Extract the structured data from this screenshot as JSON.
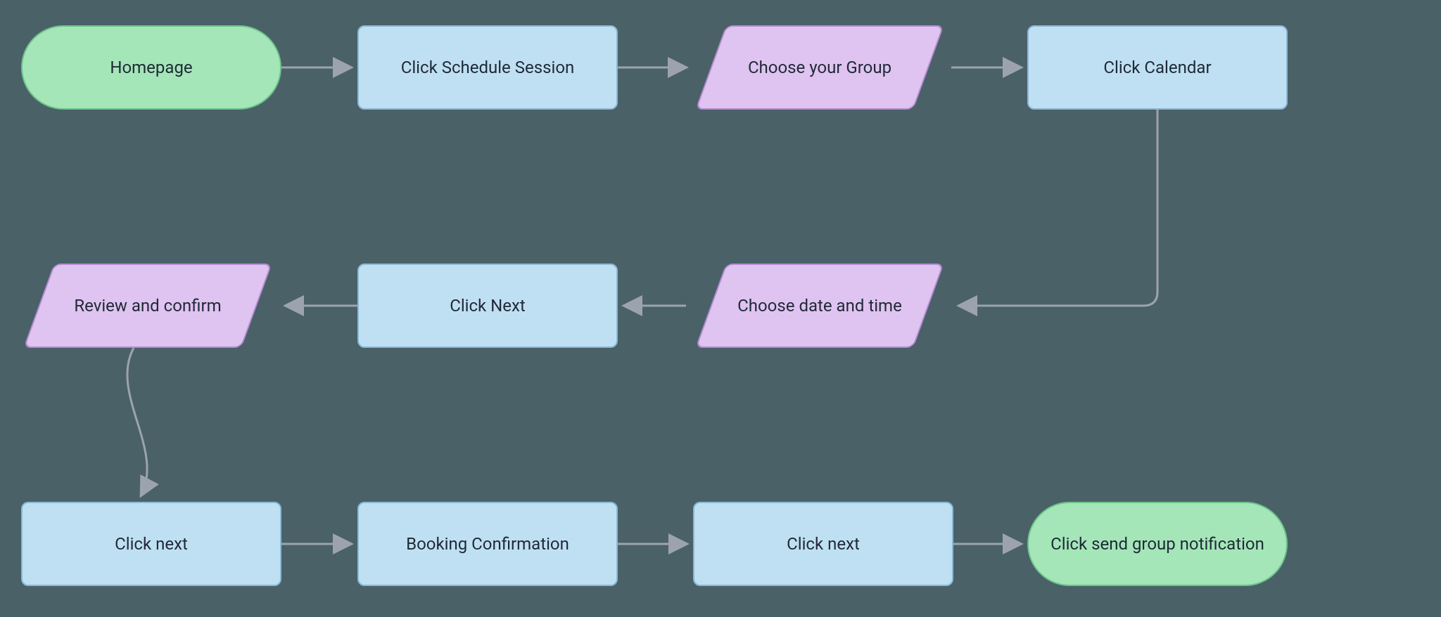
{
  "nodes": {
    "n1": "Homepage",
    "n2": "Click Schedule Session",
    "n3": "Choose your Group",
    "n4": "Click Calendar",
    "n5": "Choose date and time",
    "n6": "Click Next",
    "n7": "Review and confirm",
    "n8": "Click next",
    "n9": "Booking Confirmation",
    "n10": "Click next",
    "n11": "Click send group notification"
  },
  "colors": {
    "background": "#4a6168",
    "terminator_fill": "#a4e6b8",
    "terminator_stroke": "#6cc38b",
    "process_fill": "#bfe0f2",
    "process_stroke": "#8bb8d4",
    "io_fill": "#dfc3f0",
    "io_stroke": "#b48dd1",
    "arrow": "#9ca3af"
  },
  "flow": [
    "n1",
    "n2",
    "n3",
    "n4",
    "n5",
    "n6",
    "n7",
    "n8",
    "n9",
    "n10",
    "n11"
  ]
}
